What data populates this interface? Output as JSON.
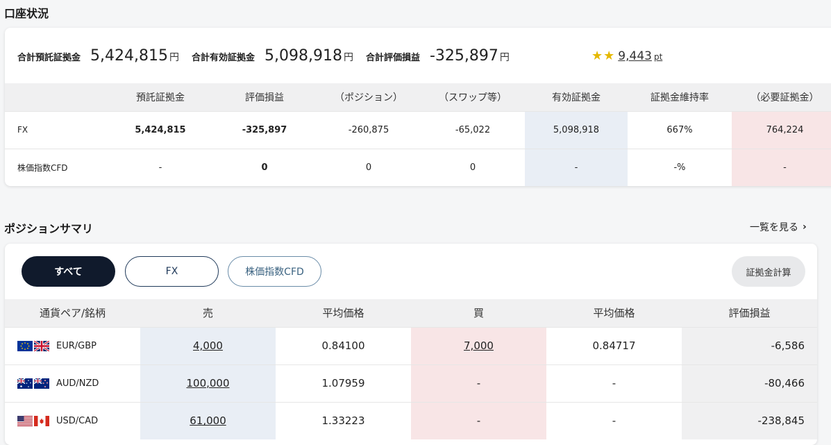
{
  "account": {
    "title": "口座状況",
    "summary": [
      {
        "label": "合計預託証拠金",
        "value": "5,424,815",
        "unit": "円"
      },
      {
        "label": "合計有効証拠金",
        "value": "5,098,918",
        "unit": "円"
      },
      {
        "label": "合計評価損益",
        "value": "-325,897",
        "unit": "円"
      }
    ],
    "points": {
      "value": "9,443",
      "unit": "pt",
      "stars": 2
    },
    "headers": [
      "",
      "預託証拠金",
      "評価損益",
      "（ポジション）",
      "（スワップ等）",
      "有効証拠金",
      "証拠金維持率",
      "（必要証拠金）"
    ],
    "rows": [
      [
        "FX",
        "5,424,815",
        "-325,897",
        "-260,875",
        "-65,022",
        "5,098,918",
        "667%",
        "764,224"
      ],
      [
        "株価指数CFD",
        "-",
        "0",
        "0",
        "0",
        "-",
        "-%",
        "-"
      ]
    ]
  },
  "positions": {
    "title": "ポジションサマリ",
    "more_label": "一覧を見る",
    "filters": [
      "すべて",
      "FX",
      "株価指数CFD"
    ],
    "calc_label": "証拠金計算",
    "headers": [
      "通貨ペア/銘柄",
      "売",
      "平均価格",
      "買",
      "平均価格",
      "評価損益"
    ],
    "rows": [
      {
        "flags": [
          "eu-flag-icon",
          "uk-flag-icon"
        ],
        "pair": "EUR/GBP",
        "sell": "4,000",
        "sell_avg": "0.84100",
        "buy": "7,000",
        "buy_avg": "0.84717",
        "pnl": "-6,586"
      },
      {
        "flags": [
          "au-flag-icon",
          "nz-flag-icon"
        ],
        "pair": "AUD/NZD",
        "sell": "100,000",
        "sell_avg": "1.07959",
        "buy": "-",
        "buy_avg": "-",
        "pnl": "-80,466"
      },
      {
        "flags": [
          "us-flag-icon",
          "ca-flag-icon"
        ],
        "pair": "USD/CAD",
        "sell": "61,000",
        "sell_avg": "1.33223",
        "buy": "-",
        "buy_avg": "-",
        "pnl": "-238,845"
      }
    ]
  }
}
